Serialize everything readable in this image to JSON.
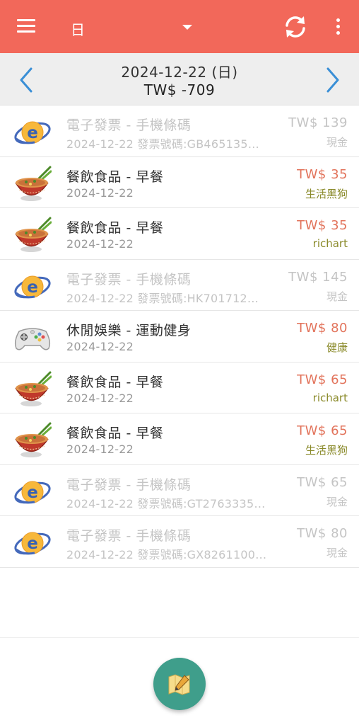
{
  "appbar": {
    "period_label": "日",
    "background_color": "#f2685a"
  },
  "datebar": {
    "date": "2024-12-22 (日)",
    "total": "TW$ -709"
  },
  "rows": [
    {
      "icon": "e-invoice-icon",
      "title": "電子發票 - 手機條碼",
      "sub": "2024-12-22 發票號碼:GB465135…",
      "amount": "TW$ 139",
      "account": "現金",
      "muted": true
    },
    {
      "icon": "noodle-bowl-icon",
      "title": "餐飲食品 - 早餐",
      "sub": "2024-12-22",
      "amount": "TW$ 35",
      "account": "生活黑狗",
      "muted": false
    },
    {
      "icon": "noodle-bowl-icon",
      "title": "餐飲食品 - 早餐",
      "sub": "2024-12-22",
      "amount": "TW$ 35",
      "account": "richart",
      "muted": false
    },
    {
      "icon": "e-invoice-icon",
      "title": "電子發票 - 手機條碼",
      "sub": "2024-12-22 發票號碼:HK701712…",
      "amount": "TW$ 145",
      "account": "現金",
      "muted": true
    },
    {
      "icon": "game-controller-icon",
      "title": "休閒娛樂 - 運動健身",
      "sub": "2024-12-22",
      "amount": "TW$ 80",
      "account": "健康",
      "muted": false
    },
    {
      "icon": "noodle-bowl-icon",
      "title": "餐飲食品 - 早餐",
      "sub": "2024-12-22",
      "amount": "TW$ 65",
      "account": "richart",
      "muted": false
    },
    {
      "icon": "noodle-bowl-icon",
      "title": "餐飲食品 - 早餐",
      "sub": "2024-12-22",
      "amount": "TW$ 65",
      "account": "生活黑狗",
      "muted": false
    },
    {
      "icon": "e-invoice-icon",
      "title": "電子發票 - 手機條碼",
      "sub": "2024-12-22 發票號碼:GT2763335…",
      "amount": "TW$ 65",
      "account": "現金",
      "muted": true
    },
    {
      "icon": "e-invoice-icon",
      "title": "電子發票 - 手機條碼",
      "sub": "2024-12-22 發票號碼:GX8261100…",
      "amount": "TW$ 80",
      "account": "現金",
      "muted": true
    }
  ],
  "fab": {
    "icon": "map-pencil-icon",
    "color": "#3f9e8b"
  },
  "colors": {
    "expense": "#e2735b",
    "account": "#8a8a2a",
    "muted": "#c4c4c4"
  }
}
